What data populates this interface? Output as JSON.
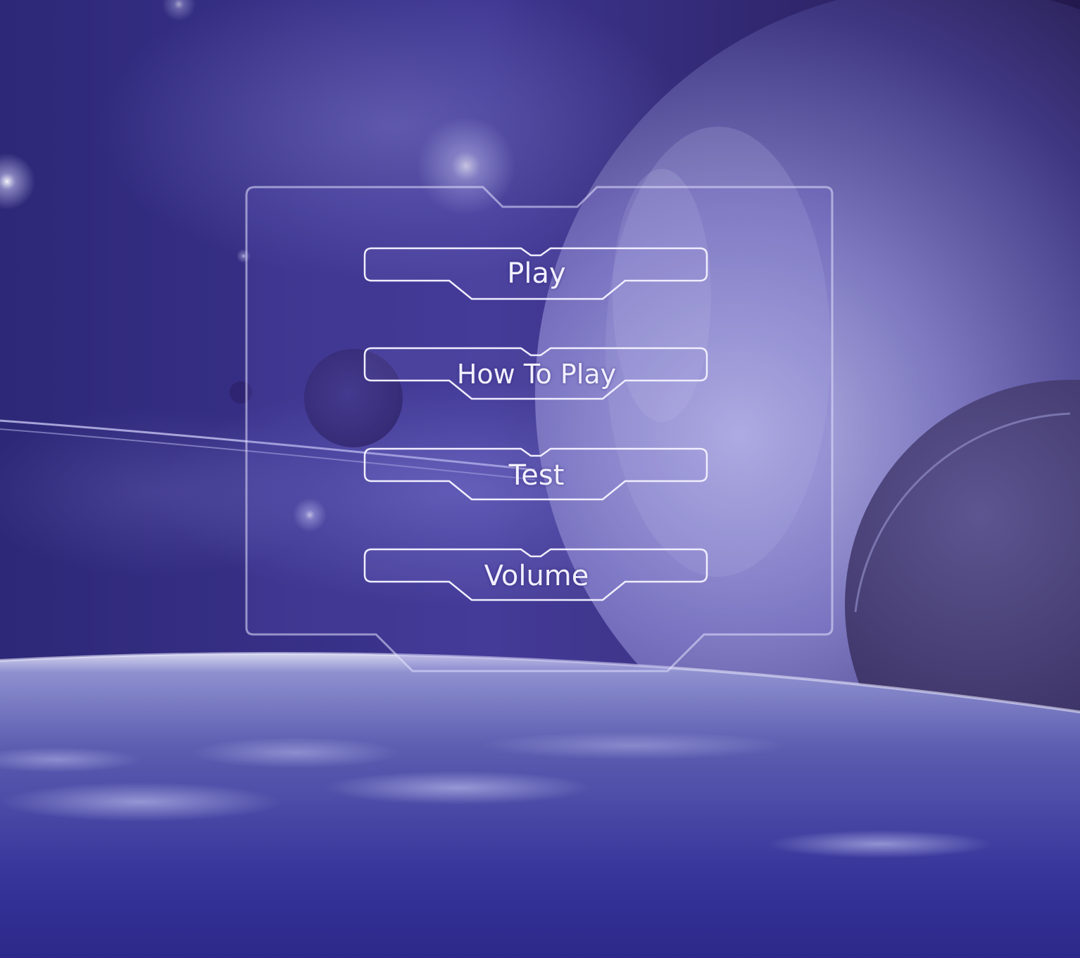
{
  "screen": "main-menu",
  "menu": {
    "buttons": [
      {
        "id": "play",
        "label": "Play"
      },
      {
        "id": "how-to-play",
        "label": "How To Play"
      },
      {
        "id": "test",
        "label": "Test"
      },
      {
        "id": "volume",
        "label": "Volume"
      }
    ]
  },
  "colors": {
    "background_deep": "#1f1a55",
    "background_mid": "#3c3290",
    "outline": "#e6e4ff",
    "panel_fill": "#6a5fc4",
    "label_text": "#f2f0ff"
  }
}
